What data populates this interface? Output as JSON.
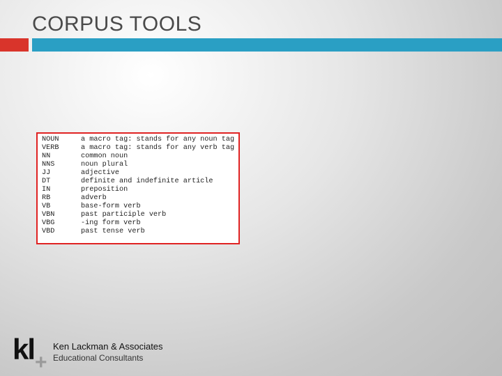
{
  "slide": {
    "title": "CORPUS TOOLS",
    "accent_colors": {
      "red": "#d9342b",
      "teal": "#2a9fc4",
      "box_border": "#e02222"
    }
  },
  "tag_table": {
    "rows": [
      {
        "code": "NOUN",
        "desc": "a macro tag: stands for any noun tag"
      },
      {
        "code": "VERB",
        "desc": "a macro tag: stands for any verb tag"
      },
      {
        "code": "NN",
        "desc": "common noun"
      },
      {
        "code": "NNS",
        "desc": "noun plural"
      },
      {
        "code": "JJ",
        "desc": "adjective"
      },
      {
        "code": "DT",
        "desc": "definite and indefinite article"
      },
      {
        "code": "IN",
        "desc": "preposition"
      },
      {
        "code": "RB",
        "desc": "adverb"
      },
      {
        "code": "VB",
        "desc": "base-form verb"
      },
      {
        "code": "VBN",
        "desc": "past participle verb"
      },
      {
        "code": "VBG",
        "desc": "-ing form verb"
      },
      {
        "code": "VBD",
        "desc": "past tense verb"
      }
    ]
  },
  "footer": {
    "logo_letters": "kl",
    "logo_plus": "+",
    "company": "Ken Lackman & Associates",
    "tagline": "Educational Consultants"
  }
}
